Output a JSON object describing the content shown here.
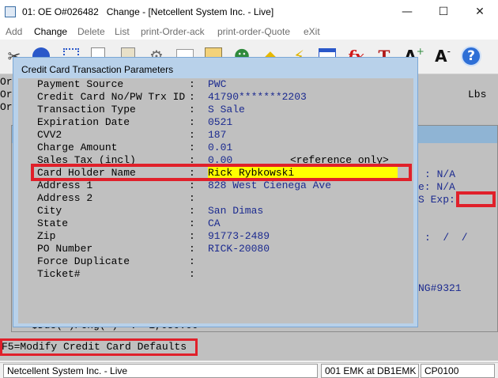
{
  "window": {
    "title": "01: OE O#026482   Change - [Netcellent System Inc. - Live]",
    "controls": {
      "minimize": "—",
      "maximize": "☐",
      "close": "✕"
    }
  },
  "menu": [
    "Add",
    "Change",
    "Delete",
    "List",
    "print-Order-ack",
    "print-order-Quote",
    "eXit"
  ],
  "toolbar": {
    "icons": [
      "scissors-icon",
      "globe-icon",
      "select-icon",
      "copy-icon",
      "paste-icon",
      "settings-icon",
      "edit-icon",
      "note-icon",
      "users-icon",
      "tag-icon",
      "lightning-icon",
      "window-icon",
      "fx-icon",
      "text-icon",
      "font-grow-icon",
      "font-shrink-icon",
      "help-icon"
    ],
    "fx_label": "fx",
    "t_label": "T",
    "a_plus": "A",
    "a_minus": "A",
    "help": "?"
  },
  "background": {
    "left_codes": [
      "Or",
      "Or",
      "Or"
    ],
    "lbs": "Lbs",
    "right_1": ": N/A",
    "right_2": "e: N/A",
    "right_3": "S Exp:",
    "right_4": ":  /  /",
    "right_5": "NG#9321",
    "due_line": "$Due(+)/Chg(-)  :  1,050.00"
  },
  "function_keys": "F5=Modify Credit Card Defaults",
  "status": {
    "company": "Netcellent System Inc. - Live",
    "user": "001 EMK at DB1EMK",
    "program": "CP0100"
  },
  "dialog": {
    "title": "Credit Card Transaction Parameters",
    "colon": ":",
    "fields": [
      {
        "label": "Payment Source",
        "value": "PWC"
      },
      {
        "label": "Credit Card No/PW Trx ID",
        "value": "41790*******2203"
      },
      {
        "label": "Transaction Type",
        "value": "S Sale"
      },
      {
        "label": "Expiration Date",
        "value": "0521"
      },
      {
        "label": "CVV2",
        "value": "187"
      },
      {
        "label": "Charge Amount",
        "value": "0.01"
      },
      {
        "label": "Sales Tax (incl)",
        "value": "0.00",
        "note": "<reference only>"
      },
      {
        "label": "Card Holder Name",
        "value": "Rick Rybkowski"
      },
      {
        "label": "Address 1",
        "value": "828 West Cienega Ave"
      },
      {
        "label": "Address 2",
        "value": ""
      },
      {
        "label": "City",
        "value": "San Dimas"
      },
      {
        "label": "State",
        "value": "CA"
      },
      {
        "label": "Zip",
        "value": "91773-2489"
      },
      {
        "label": "PO Number",
        "value": "RICK-20080"
      },
      {
        "label": "Force Duplicate",
        "value": ""
      },
      {
        "label": "Ticket#",
        "value": ""
      }
    ]
  },
  "colors": {
    "highlight_border": "#e0202a",
    "field_value": "#1b2a8f",
    "input_highlight": "#ffff00",
    "dialog_frame": "#b8d1ea"
  }
}
